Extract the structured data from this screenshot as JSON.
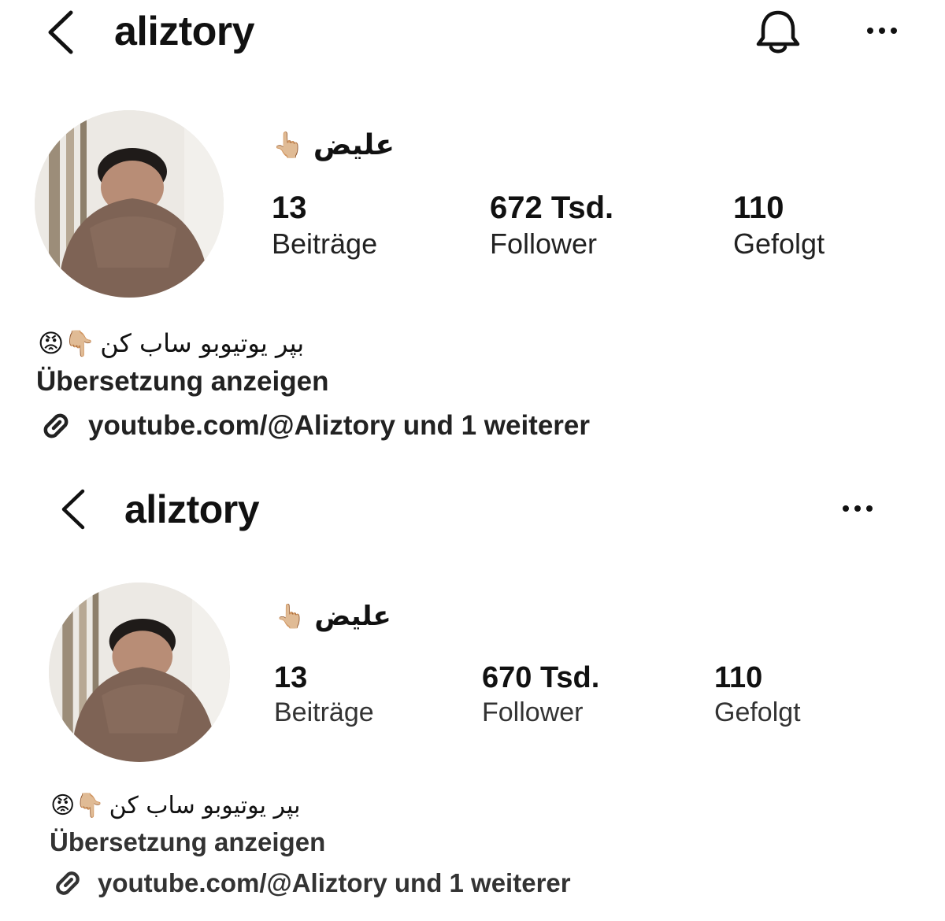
{
  "colors": {
    "text": "#111111",
    "background": "#ffffff",
    "avatar_shirt": "#7e6355",
    "avatar_hair": "#1f1b19",
    "avatar_skin": "#b88d76"
  },
  "screenshots": [
    {
      "header": {
        "back_icon": "chevron-left-icon",
        "username": "aliztory",
        "bell_icon": "bell-icon",
        "more_icon": "more-horizontal-icon"
      },
      "profile": {
        "display_name": "عليض",
        "display_name_emoji": "👆🏼",
        "stats": [
          {
            "value": "13",
            "label": "Beiträge"
          },
          {
            "value": "672 Tsd.",
            "label": "Follower"
          },
          {
            "value": "110",
            "label": "Gefolgt"
          }
        ],
        "bio_text": "بپر یوتیوبو ساب کن",
        "bio_emojis": "😡👇🏼",
        "translate_label": "Übersetzung anzeigen",
        "link_icon": "link-icon",
        "link_text": "youtube.com/@Aliztory und 1 weiterer"
      }
    },
    {
      "header": {
        "back_icon": "chevron-left-icon",
        "username": "aliztory",
        "more_icon": "more-horizontal-icon"
      },
      "profile": {
        "display_name": "عليض",
        "display_name_emoji": "👆🏼",
        "stats": [
          {
            "value": "13",
            "label": "Beiträge"
          },
          {
            "value": "670 Tsd.",
            "label": "Follower"
          },
          {
            "value": "110",
            "label": "Gefolgt"
          }
        ],
        "bio_text": "بپر یوتیوبو ساب کن",
        "bio_emojis": "😡👇🏼",
        "translate_label": "Übersetzung anzeigen",
        "link_icon": "link-icon",
        "link_text": "youtube.com/@Aliztory und 1 weiterer"
      }
    }
  ]
}
